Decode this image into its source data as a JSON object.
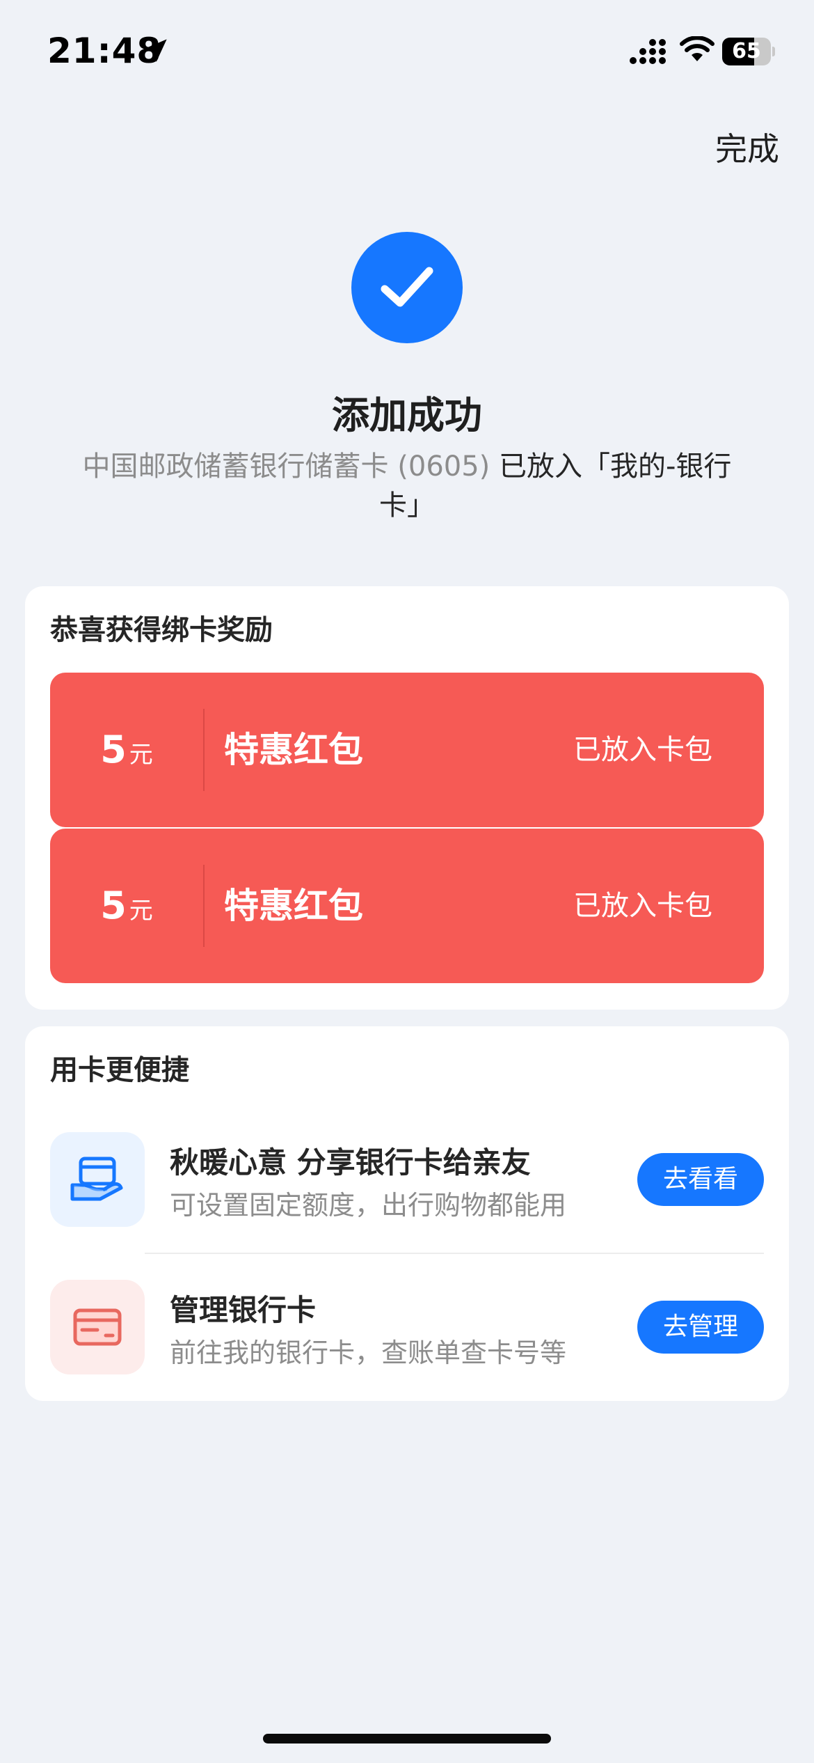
{
  "status_bar": {
    "time": "21:48",
    "battery_level": "65",
    "battery_fraction": 0.65,
    "icons": [
      "location-arrow-icon",
      "cell-signal-icon",
      "wifi-icon",
      "battery-icon"
    ]
  },
  "nav": {
    "done_label": "完成"
  },
  "success": {
    "icon": "checkmark-icon",
    "title": "添加成功",
    "desc_muted": "中国邮政储蓄银行储蓄卡 (0605)",
    "desc_rest": " 已放入「我的-银行卡」"
  },
  "rewards": {
    "title": "恭喜获得绑卡奖励",
    "coupons": [
      {
        "amount": "5",
        "unit": "元",
        "name": "特惠红包",
        "status": "已放入卡包"
      },
      {
        "amount": "5",
        "unit": "元",
        "name": "特惠红包",
        "status": "已放入卡包"
      }
    ]
  },
  "convenience": {
    "title": "用卡更便捷",
    "items": [
      {
        "icon": "card-in-hand-icon",
        "title": "秋暖心意 分享银行卡给亲友",
        "subtitle": "可设置固定额度，出行购物都能用",
        "button": "去看看"
      },
      {
        "icon": "bank-card-icon",
        "title": "管理银行卡",
        "subtitle": "前往我的银行卡，查账单查卡号等",
        "button": "去管理"
      }
    ]
  },
  "colors": {
    "accent": "#1677ff",
    "coupon_red": "#f65a55",
    "background": "#eff2f7"
  }
}
